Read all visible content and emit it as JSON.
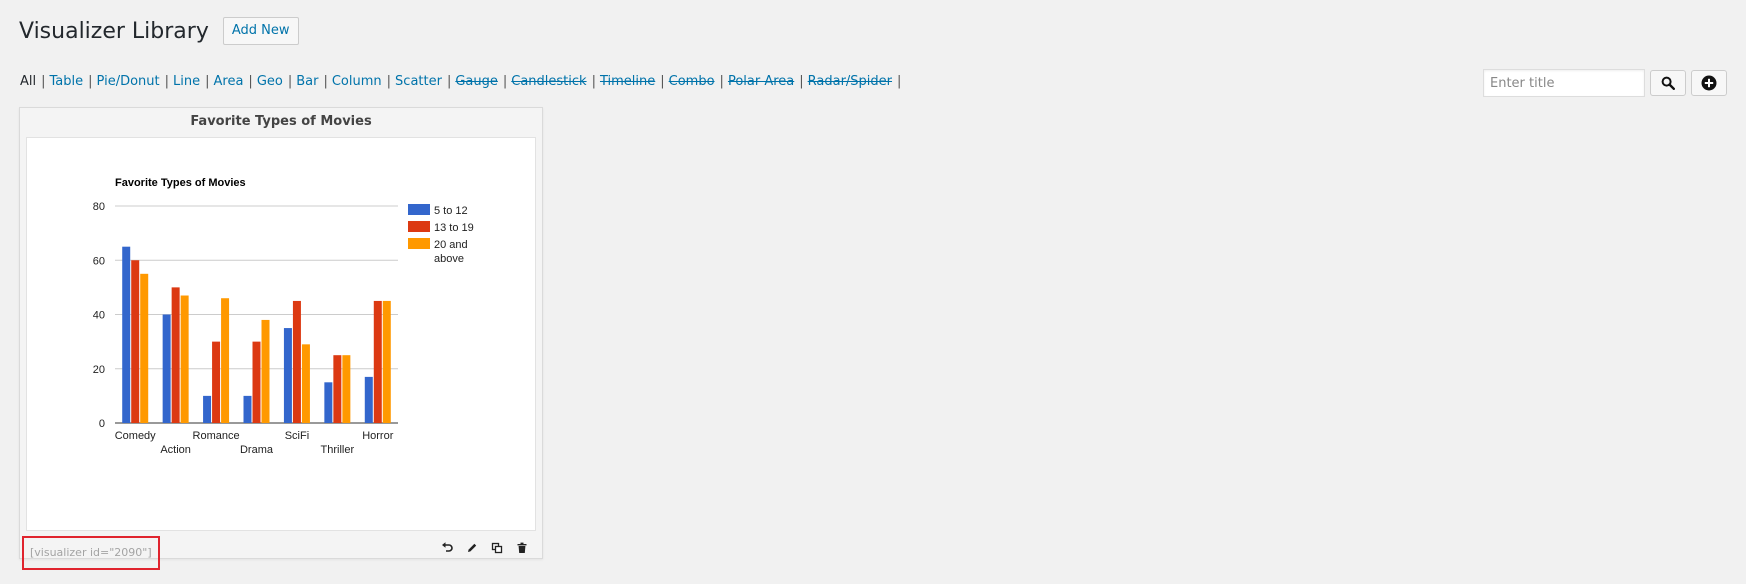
{
  "header": {
    "title": "Visualizer Library",
    "add_new_label": "Add New"
  },
  "filters": [
    {
      "label": "All",
      "state": "current"
    },
    {
      "label": "Table",
      "state": "enabled"
    },
    {
      "label": "Pie/Donut",
      "state": "enabled"
    },
    {
      "label": "Line",
      "state": "enabled"
    },
    {
      "label": "Area",
      "state": "enabled"
    },
    {
      "label": "Geo",
      "state": "enabled"
    },
    {
      "label": "Bar",
      "state": "enabled"
    },
    {
      "label": "Column",
      "state": "enabled"
    },
    {
      "label": "Scatter",
      "state": "enabled"
    },
    {
      "label": "Gauge",
      "state": "disabled"
    },
    {
      "label": "Candlestick",
      "state": "disabled"
    },
    {
      "label": "Timeline",
      "state": "disabled"
    },
    {
      "label": "Combo",
      "state": "disabled"
    },
    {
      "label": "Polar Area",
      "state": "disabled"
    },
    {
      "label": "Radar/Spider",
      "state": "disabled"
    }
  ],
  "filter_separator": "|",
  "search": {
    "placeholder": "Enter title",
    "value": "",
    "search_icon": "search-icon",
    "add_icon": "plus-circle-icon"
  },
  "card": {
    "title": "Favorite Types of Movies",
    "shortcode": "[visualizer id=\"2090\"]",
    "actions": [
      "undo-icon",
      "edit-pencil-icon",
      "copy-icon",
      "trash-icon"
    ]
  },
  "chart_data": {
    "type": "bar",
    "title": "Favorite Types of Movies",
    "categories": [
      "Comedy",
      "Action",
      "Romance",
      "Drama",
      "SciFi",
      "Thriller",
      "Horror"
    ],
    "series": [
      {
        "name": "5 to 12",
        "color": "#3366cc",
        "values": [
          65,
          40,
          10,
          10,
          35,
          15,
          17
        ]
      },
      {
        "name": "13 to 19",
        "color": "#dc3912",
        "values": [
          60,
          50,
          30,
          30,
          45,
          25,
          45
        ]
      },
      {
        "name": "20 and above",
        "color": "#ff9900",
        "values": [
          55,
          47,
          46,
          38,
          29,
          25,
          45
        ]
      }
    ],
    "ylim": [
      0,
      80
    ],
    "yticks": [
      0,
      20,
      40,
      60,
      80
    ],
    "xlabel": "",
    "ylabel": "",
    "grid": true,
    "legend": "right"
  }
}
